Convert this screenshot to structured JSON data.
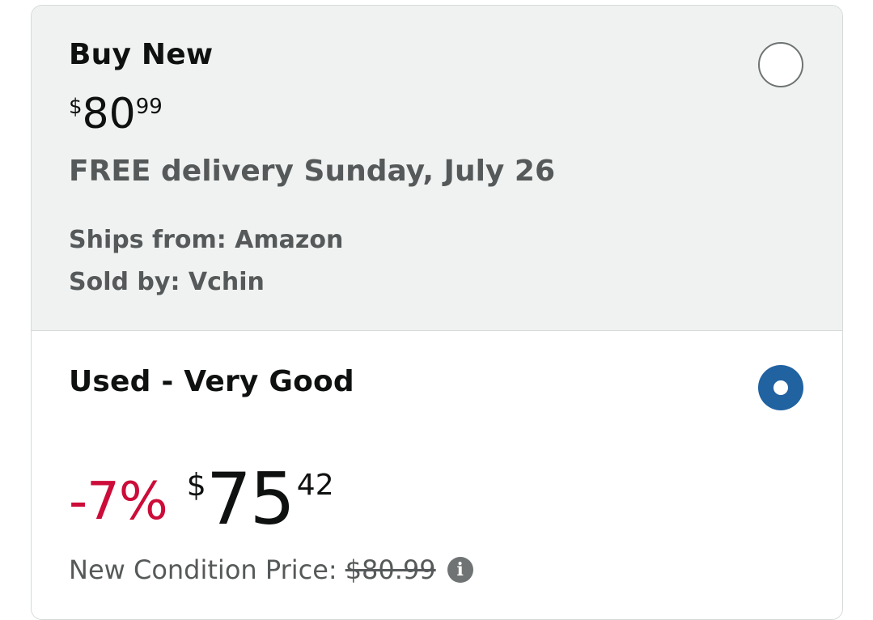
{
  "buy_new": {
    "title": "Buy New",
    "price": {
      "symbol": "$",
      "whole": "80",
      "fraction": "99"
    },
    "delivery": "FREE delivery Sunday, July 26",
    "ships_from": "Ships from: Amazon",
    "sold_by": "Sold by: Vchin",
    "selected": false
  },
  "used": {
    "title": "Used - Very Good",
    "discount": "-7%",
    "price": {
      "symbol": "$",
      "whole": "75",
      "fraction": "42"
    },
    "new_condition_label": "New Condition Price:",
    "new_condition_price": "$80.99",
    "selected": true
  },
  "icons": {
    "info": "info-icon",
    "radio_selected": "radio-selected-icon",
    "radio_unselected": "radio-unselected-icon"
  },
  "colors": {
    "discount": "#cc0c39",
    "radio_selected": "#2162a1",
    "secondary_text": "#565959",
    "panel_bg": "#f0f2f2"
  }
}
